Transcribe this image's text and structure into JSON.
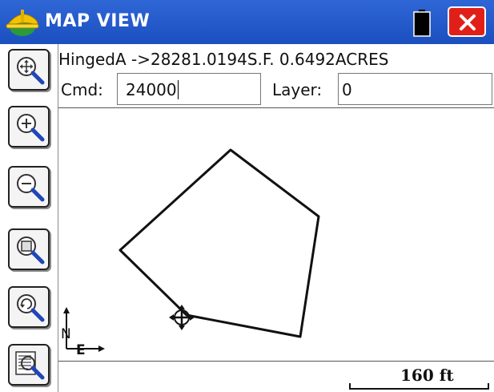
{
  "window": {
    "title": "MAP VIEW",
    "close_icon": "close-icon",
    "battery_icon": "battery-icon",
    "logo_icon": "hardhat-logo-icon"
  },
  "info": {
    "text": "HingedA ->28281.0194S.F. 0.6492ACRES"
  },
  "command": {
    "label": "Cmd:",
    "value": "24000"
  },
  "layer": {
    "label": "Layer:",
    "value": "0"
  },
  "toolbar": {
    "tools": [
      {
        "name": "zoom-extents",
        "icon": "zoom-extents-icon"
      },
      {
        "name": "zoom-in",
        "icon": "zoom-in-icon"
      },
      {
        "name": "zoom-out",
        "icon": "zoom-out-icon"
      },
      {
        "name": "zoom-window",
        "icon": "zoom-window-icon"
      },
      {
        "name": "zoom-previous",
        "icon": "zoom-previous-icon"
      },
      {
        "name": "zoom-list",
        "icon": "zoom-list-icon"
      }
    ]
  },
  "map": {
    "north_label": "N",
    "east_label": "E"
  },
  "scale": {
    "label": "160 ft"
  },
  "colors": {
    "titlebar": "#1f56c9",
    "close_button": "#e02018",
    "drawing": "#111111"
  }
}
